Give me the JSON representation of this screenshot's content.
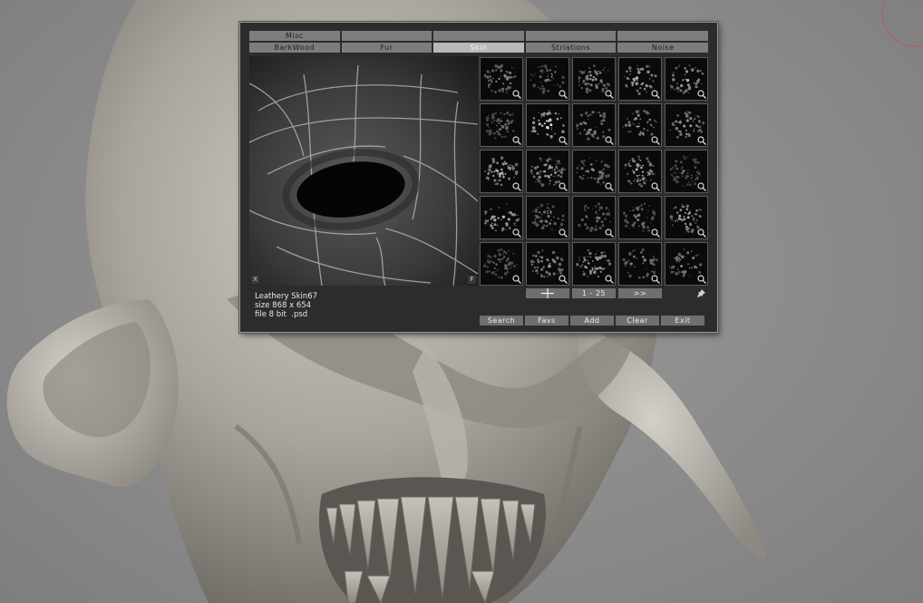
{
  "tabs_top": [
    "Misc",
    "",
    "",
    "",
    ""
  ],
  "tabs_bottom": [
    "BarkWood",
    "Fur",
    "Skin",
    "Striations",
    "Noise"
  ],
  "active_tab": "Skin",
  "preview": {
    "corner_left": "X",
    "corner_right": "F"
  },
  "info": {
    "name": "Leathery Skin67",
    "size": "size 868 x 654",
    "file": "file 8 bit  .psd"
  },
  "pager": {
    "prev_icon": "crosshair-icon",
    "range": "1 - 25",
    "next": ">>"
  },
  "buttons": {
    "search": "Search",
    "favs": "Favs",
    "add": "Add",
    "clear": "Clear",
    "exit": "Exit"
  },
  "thumbnail_count": 25,
  "colors": {
    "palette_bg": "#2c2c2c",
    "tab_active": "#b8b8b8",
    "tab": "#7d7d7d",
    "button": "#6f6f6f"
  }
}
